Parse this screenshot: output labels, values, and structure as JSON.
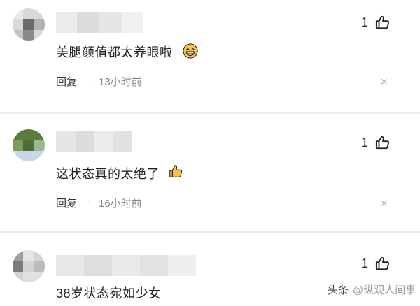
{
  "comments": [
    {
      "like_count": "1",
      "text": "美腿颜值都太养眼啦",
      "emoji": "grinning-face-emoji",
      "reply_label": "回复",
      "time": "13小时前"
    },
    {
      "like_count": "1",
      "text": "这状态真的太绝了",
      "emoji": "thumbs-up-emoji",
      "reply_label": "回复",
      "time": "16小时前"
    },
    {
      "like_count": "1",
      "text": "38岁状态宛如少女"
    }
  ],
  "watermark": {
    "brand": "头条",
    "author": "@纵观人间事"
  },
  "icons": {
    "like": "thumbs-up-icon",
    "close": "close-icon"
  },
  "colors": {
    "emoji_yellow": "#f5c542",
    "divider": "#ececec",
    "time_gray": "#888888"
  }
}
